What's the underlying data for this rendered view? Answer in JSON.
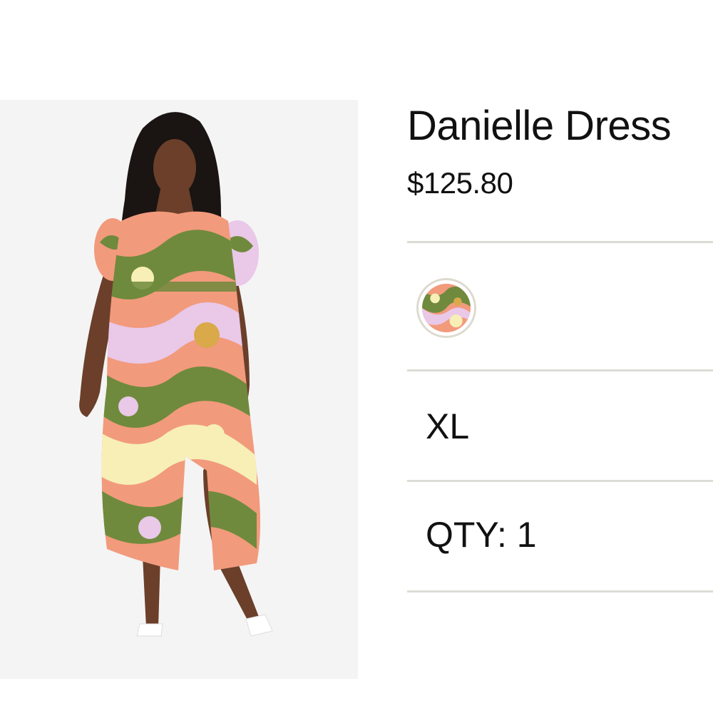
{
  "product": {
    "title": "Danielle Dress",
    "price": "$125.80",
    "image_alt": "Model wearing a green, coral and pink swirl print midi dress with puff sleeves and white heeled sandals"
  },
  "options": {
    "color_swatch_icon": "swirl-print-swatch",
    "size": "XL",
    "quantity": "QTY: 1"
  },
  "colors": {
    "divider": "#dcdcd6",
    "text": "#111111",
    "print_green": "#6f8a3c",
    "print_coral": "#f29a7c",
    "print_pink": "#e9c8e8",
    "print_cream": "#f7efb6",
    "print_mustard": "#d9a94a"
  }
}
